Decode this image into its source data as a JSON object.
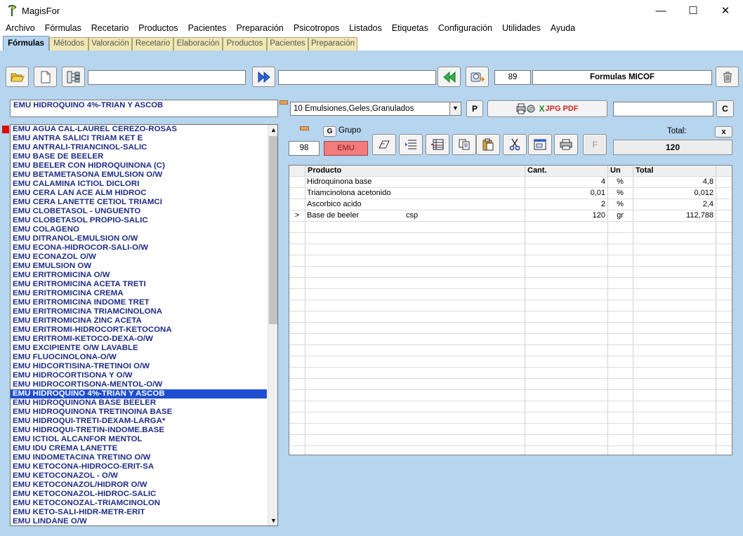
{
  "window": {
    "title": "MagisFor",
    "minimize": "—",
    "maximize": "☐",
    "close": "✕"
  },
  "menu": [
    "Archivo",
    "Fórmulas",
    "Recetario",
    "Productos",
    "Pacientes",
    "Preparación",
    "Psicotropos",
    "Listados",
    "Etiquetas",
    "Configuración",
    "Utilidades",
    "Ayuda"
  ],
  "tabs": [
    "Fórmulas",
    "Métodos",
    "Valoración",
    "Recetario",
    "Elaboración",
    "Productos",
    "Pacientes",
    "Preparación"
  ],
  "active_tab": "Fórmulas",
  "toolbar": {
    "search1_value": "",
    "search2_value": "",
    "record_number": "89",
    "list_name": "Formulas MICOF"
  },
  "formula": {
    "name": "EMU HIDROQUINO 4%-TRIAN Y ASCOB",
    "category": "10 Emulsiones,Geles,Granulados",
    "p_button": "P",
    "print_jpg": "JPG",
    "print_pdf": "PDF",
    "code_field": "",
    "c_button": "C",
    "group_button": "G",
    "group_label": "Grupo",
    "group_number": "98",
    "group_code": "EMU",
    "f_button": "F",
    "total_label": "Total:",
    "total_close": "x",
    "total_value": "120"
  },
  "formula_list": [
    "EMU AGUA CAL-LAUREL CEREZO-ROSAS",
    "EMU ANTRA SALICI TRIAM KET E",
    "EMU ANTRALI-TRIANCINOL-SALIC",
    "EMU BASE DE BEELER",
    "EMU BEELER CON HIDROQUINONA (C)",
    "EMU BETAMETASONA EMULSION O/W",
    "EMU CALAMINA ICTIOL DICLORI",
    "EMU CERA LAN ACE ALM HIDROC",
    "EMU CERA LANETTE CETIOL TRIAMCI",
    "EMU CLOBETASOL - UNGUENTO",
    "EMU CLOBETASOL PROPIO-SALIC",
    "EMU COLAGENO",
    "EMU DITRANOL-EMULSION O/W",
    "EMU ECONA-HIDROCOR-SALI-O/W",
    "EMU ECONAZOL O/W",
    "EMU EMULSION OW",
    "EMU ERITROMICINA  O/W",
    "EMU ERITROMICINA ACETA TRETI",
    "EMU ERITROMICINA CREMA",
    "EMU ERITROMICINA INDOME TRET",
    "EMU ERITROMICINA TRIAMCINOLONA",
    "EMU ERITROMICINA ZINC ACETA",
    "EMU ERITROMI-HIDROCORT-KETOCONA",
    "EMU ERITROMI-KETOCO-DEXA-O/W",
    "EMU EXCIPIENTE O/W LAVABLE",
    "EMU FLUOCINOLONA-O/W",
    "EMU HIDCORTISINA-TRETINOI O/W",
    "EMU HIDROCORTISONA Y O/W",
    "EMU HIDROCORTISONA-MENTOL-O/W",
    "EMU HIDROQUINO 4%-TRIAN Y ASCOB",
    "EMU HIDROQUINONA BASE BEELER",
    "EMU HIDROQUINONA TRETINOINA BASE",
    "EMU HIDROQUI-TRETI-DEXAM-LARGA*",
    "EMU HIDROQUI-TRETIN-INDOME.BASE",
    "EMU ICTIOL ALCANFOR MENTOL",
    "EMU IDU CREMA LANETTE",
    "EMU INDOMETACINA TRETINO O/W",
    "EMU KETOCONA-HIDROCO-ERIT-SA",
    "EMU KETOCONAZOL - O/W",
    "EMU KETOCONAZOL/HIDROR O/W",
    "EMU KETOCONAZOL-HIDROC-SALIC",
    "EMU KETOCONOZAL-TRIAMCINOLON",
    "EMU KETO-SALI-HIDR-METR-ERIT",
    "EMU LINDANE  O/W"
  ],
  "selected_index": 29,
  "grid": {
    "headers": [
      "Producto",
      "Cant.",
      "Un",
      "Total"
    ],
    "rows": [
      {
        "marker": "",
        "producto": "Hidroquinona base",
        "note": "",
        "cant": "4",
        "un": "%",
        "total": "4,8"
      },
      {
        "marker": "",
        "producto": "Triamcinolona acetonido",
        "note": "",
        "cant": "0,01",
        "un": "%",
        "total": "0,012"
      },
      {
        "marker": "",
        "producto": "Ascorbico acido",
        "note": "",
        "cant": "2",
        "un": "%",
        "total": "2,4"
      },
      {
        "marker": ">",
        "producto": "Base de beeler",
        "note": "csp",
        "cant": "120",
        "un": "gr",
        "total": "112,788"
      }
    ],
    "empty_rows": 21
  }
}
